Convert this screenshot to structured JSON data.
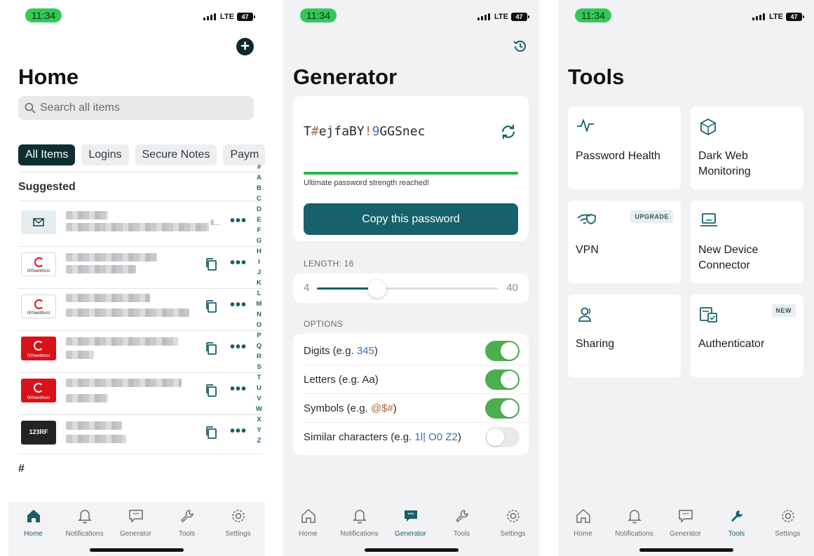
{
  "status": {
    "time": "11:34",
    "network": "LTE",
    "battery": "47"
  },
  "home": {
    "title": "Home",
    "search_placeholder": "Search all items",
    "chips": [
      "All Items",
      "Logins",
      "Secure Notes",
      "Paym"
    ],
    "section": "Suggested",
    "row_icons": [
      "envelope-icon",
      "000webhost-logo",
      "000webhost-logo",
      "000webhost-logo-red",
      "000webhost-logo-red",
      "123rf-logo"
    ],
    "logo_text_000": "000webhost",
    "logo_text_123": "123RF",
    "row_trail": "il...",
    "more_label": "•••",
    "alphabet": [
      "#",
      "A",
      "B",
      "C",
      "D",
      "E",
      "F",
      "G",
      "H",
      "I",
      "J",
      "K",
      "L",
      "M",
      "N",
      "O",
      "P",
      "Q",
      "R",
      "S",
      "T",
      "U",
      "V",
      "W",
      "X",
      "Y",
      "Z"
    ],
    "footer_hash": "#"
  },
  "generator": {
    "title": "Generator",
    "password_parts": [
      {
        "t": "T",
        "k": "c"
      },
      {
        "t": "#",
        "k": "s"
      },
      {
        "t": "ejfaBY",
        "k": "c"
      },
      {
        "t": "!",
        "k": "s"
      },
      {
        "t": "9",
        "k": "n"
      },
      {
        "t": "GGSnec",
        "k": "c"
      }
    ],
    "strength_text": "Ultimate password strength reached!",
    "copy_button": "Copy this password",
    "length_label": "LENGTH: 16",
    "length": {
      "min": "4",
      "max": "40",
      "value": 16
    },
    "options_label": "OPTIONS",
    "options": [
      {
        "prefix": "Digits (e.g. ",
        "ex": [
          {
            "t": "345",
            "k": "n"
          }
        ],
        "suffix": ")",
        "on": true
      },
      {
        "prefix": "Letters (e.g. Aa)",
        "ex": [],
        "suffix": "",
        "on": true
      },
      {
        "prefix": "Symbols (e.g. ",
        "ex": [
          {
            "t": "@$#",
            "k": "s"
          }
        ],
        "suffix": ")",
        "on": true
      },
      {
        "prefix": "Similar characters (e.g. ",
        "ex": [
          {
            "t": "1l|",
            "k": "n"
          },
          {
            "t": " ",
            "k": "c"
          },
          {
            "t": "O0",
            "k": "n"
          },
          {
            "t": " ",
            "k": "c"
          },
          {
            "t": "Z2",
            "k": "n"
          }
        ],
        "suffix": ")",
        "on": false
      }
    ]
  },
  "tools": {
    "title": "Tools",
    "items": [
      {
        "name": "Password Health",
        "icon": "pulse-icon",
        "badge": ""
      },
      {
        "name": "Dark Web Monitoring",
        "icon": "globe-cube-icon",
        "badge": ""
      },
      {
        "name": "VPN",
        "icon": "wifi-shield-icon",
        "badge": "UPGRADE"
      },
      {
        "name": "New Device Connector",
        "icon": "laptop-icon",
        "badge": ""
      },
      {
        "name": "Sharing",
        "icon": "user-share-icon",
        "badge": ""
      },
      {
        "name": "Authenticator",
        "icon": "authenticator-icon",
        "badge": "NEW"
      }
    ]
  },
  "tabbar": {
    "tabs": [
      "Home",
      "Notifications",
      "Generator",
      "Tools",
      "Settings"
    ],
    "icons": [
      "home-icon",
      "bell-icon",
      "generator-icon",
      "wrench-icon",
      "gear-icon"
    ]
  },
  "colors": {
    "accent": "#17616b",
    "green": "#34c759",
    "toggle_on": "#4cae4f",
    "symbol": "#a8663b",
    "digit": "#3a6fb0"
  }
}
